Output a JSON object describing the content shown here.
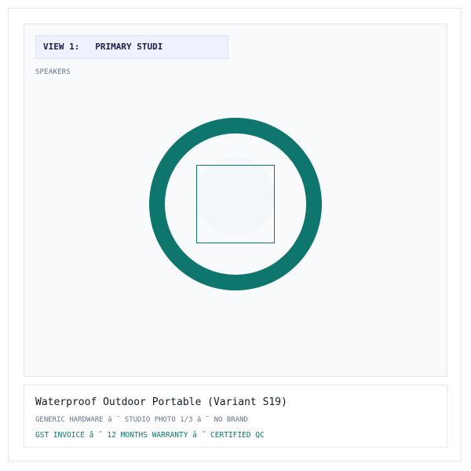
{
  "view_tag": {
    "label": "VIEW 1:   PRIMARY STUDI"
  },
  "category": "SPEAKERS",
  "product": {
    "title": "Waterproof Outdoor Portable (Variant S19)",
    "meta": "GENERIC HARDWARE â ˘ STUDIO PHOTO 1/3 â ˘ NO BRAND",
    "trust": "GST INVOICE â ˘ 12 MONTHS WARRANTY â ˘ CERTIFIED QC"
  },
  "colors": {
    "accent": "#0f766e",
    "panel_bg": "#f8fafc",
    "tag_bg": "#eef2ff",
    "tag_text": "#1e1b4b",
    "muted_text": "#64748b"
  },
  "icons": {
    "product_image": "speaker-icon"
  }
}
